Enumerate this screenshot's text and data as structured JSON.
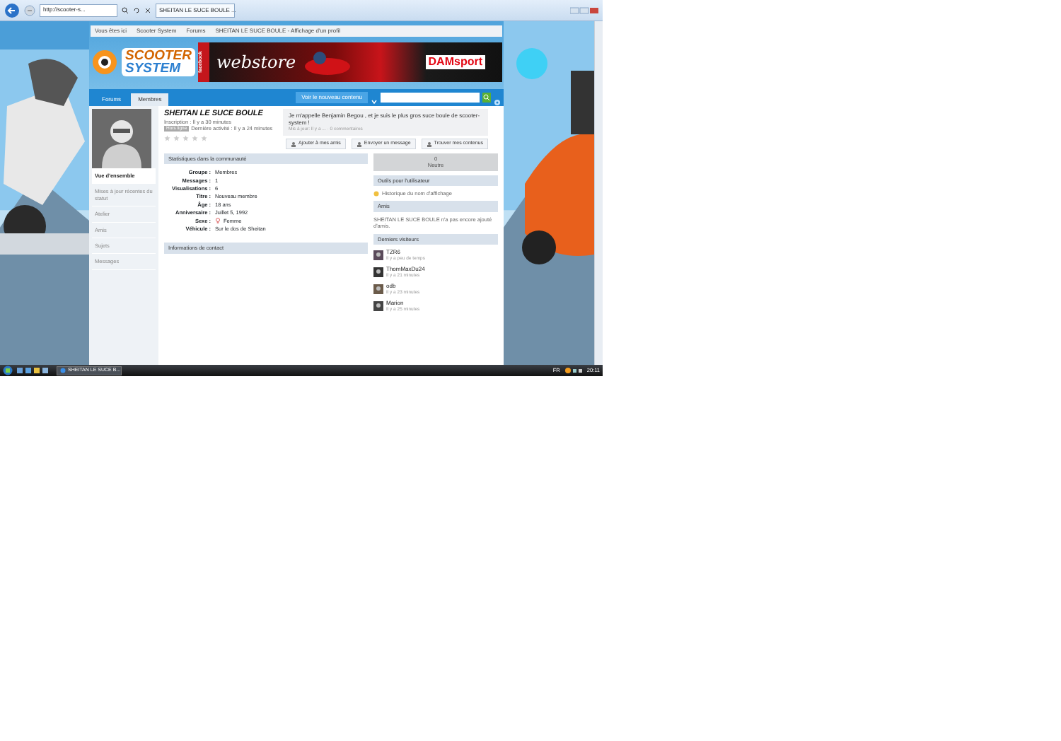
{
  "browser": {
    "address": "http://scooter-s...",
    "tab": "SHEITAN LE SUCE BOULE ..."
  },
  "breadcrumb": [
    "Vous êtes ici",
    "Scooter System",
    "Forums",
    "SHEITAN LE SUCE BOULE - Affichage d'un profil"
  ],
  "logo": {
    "line_1": "SCOOTER",
    "line_2": "SYSTEM"
  },
  "banner": {
    "side_label": "facebook",
    "title": "webstore",
    "brand": "DAMsport"
  },
  "nav": {
    "tabs": [
      {
        "label": "Forums",
        "selected": false
      },
      {
        "label": "Membres",
        "selected": true
      }
    ],
    "new_content": "Voir le nouveau contenu"
  },
  "profile": {
    "name": "SHEITAN LE SUCE BOULE",
    "joined": "Inscription : Il y a 30 minutes",
    "badge": "Hors ligne",
    "last_activity": "Dernière activité : Il y a 24 minutes",
    "stars": 0,
    "status": {
      "text": "Je m'appelle Benjamin Begou , et je suis le plus gros suce boule de scooter-system !",
      "meta": "Mis à jour: Il y a ... · 0 commentaires"
    },
    "actions": [
      "Ajouter à mes amis",
      "Envoyer un message",
      "Trouver mes contenus"
    ]
  },
  "sidebar": [
    {
      "label": "Vue d'ensemble",
      "selected": true
    },
    {
      "label": "Mises à jour récentes du statut",
      "selected": false
    },
    {
      "label": "Atelier",
      "selected": false
    },
    {
      "label": "Amis",
      "selected": false
    },
    {
      "label": "Sujets",
      "selected": false
    },
    {
      "label": "Messages",
      "selected": false
    }
  ],
  "stats": {
    "title": "Statistiques dans la communauté",
    "rows": [
      {
        "kind": "text",
        "label": "Groupe :",
        "value": "Membres"
      },
      {
        "kind": "text",
        "label": "Messages :",
        "value": "1"
      },
      {
        "kind": "text",
        "label": "Visualisations :",
        "value": "6"
      },
      {
        "kind": "text",
        "label": "Titre :",
        "value": "Nouveau membre"
      },
      {
        "kind": "text",
        "label": "Âge :",
        "value": "18 ans"
      },
      {
        "kind": "text",
        "label": "Anniversaire :",
        "value": "Juillet 5, 1992"
      },
      {
        "kind": "gender",
        "label": "Sexe :",
        "value": "Femme"
      },
      {
        "kind": "text",
        "label": "Véhicule :",
        "value": "Sur le dos de Sheitan"
      }
    ]
  },
  "contact": {
    "title": "Informations de contact"
  },
  "reputation": {
    "value": "0",
    "label": "Neutre"
  },
  "tools": {
    "title": "Outils pour l'utilisateur",
    "items": [
      "Historique du nom d'affichage"
    ]
  },
  "friends": {
    "title": "Amis",
    "text": "SHEITAN LE SUCE BOULE n'a pas encore ajouté d'amis."
  },
  "visitors": {
    "title": "Derniers visiteurs",
    "items": [
      {
        "name": "TZR6",
        "time": "Il y a peu de temps"
      },
      {
        "name": "ThomMaxDu24",
        "time": "Il y a 21 minutes"
      },
      {
        "name": "odb",
        "time": "Il y a 23 minutes"
      },
      {
        "name": "Marion",
        "time": "Il y a 25 minutes"
      }
    ]
  },
  "taskbar": {
    "window": "SHEITAN LE SUCE B...",
    "language": "FR",
    "clock": "20:11"
  }
}
